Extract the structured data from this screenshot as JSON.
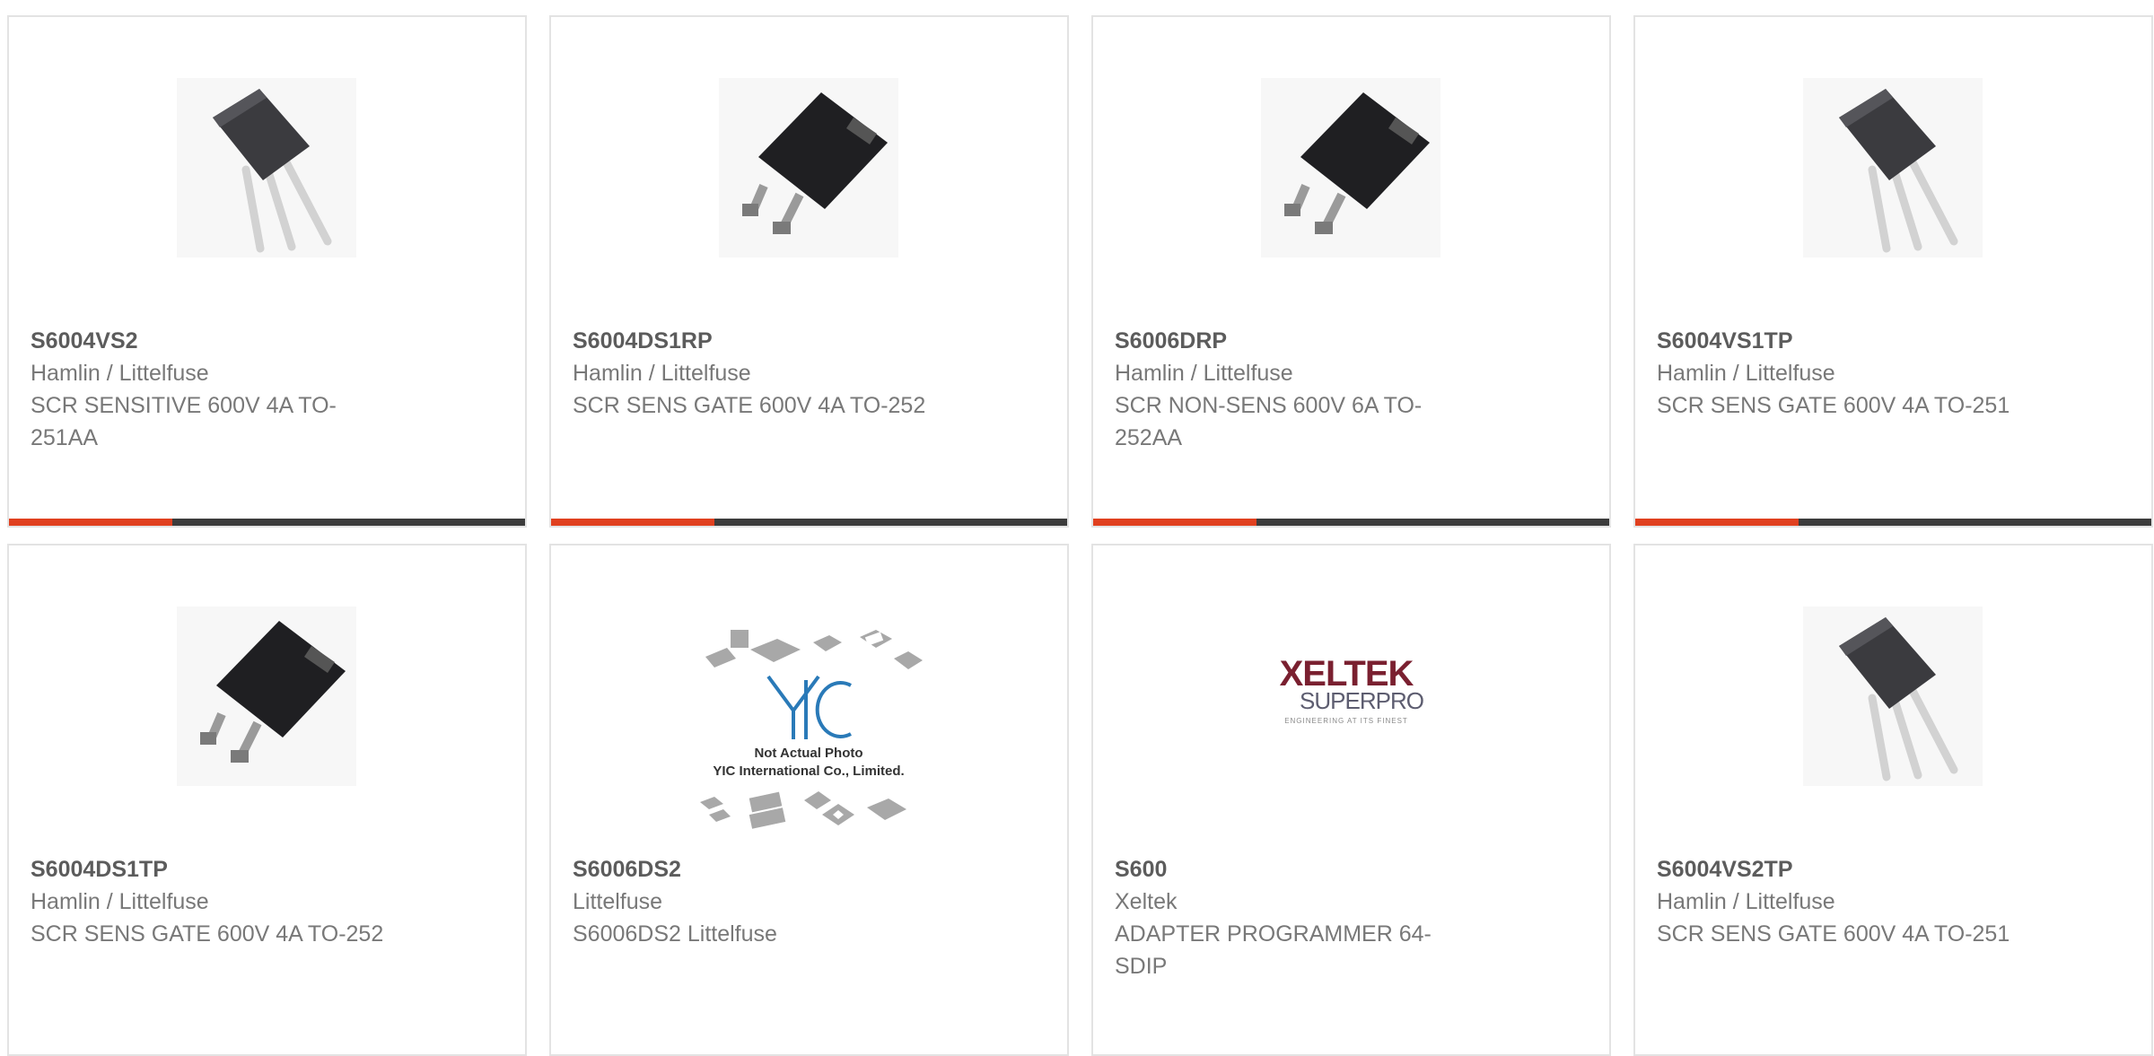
{
  "accent_color": "#e0401f",
  "bar_color": "#3c3c3c",
  "products": [
    {
      "part": "S6004VS2",
      "maker": "Hamlin / Littelfuse",
      "desc": "SCR SENSITIVE 600V 4A TO-251AA",
      "image": "to251-icon"
    },
    {
      "part": "S6004DS1RP",
      "maker": "Hamlin / Littelfuse",
      "desc": "SCR SENS GATE 600V 4A TO-252",
      "image": "to252-icon"
    },
    {
      "part": "S6006DRP",
      "maker": "Hamlin / Littelfuse",
      "desc": "SCR NON-SENS 600V 6A TO-252AA",
      "image": "to252-icon"
    },
    {
      "part": "S6004VS1TP",
      "maker": "Hamlin / Littelfuse",
      "desc": "SCR SENS GATE 600V 4A TO-251",
      "image": "to251-icon"
    },
    {
      "part": "S6004DS1TP",
      "maker": "Hamlin / Littelfuse",
      "desc": "SCR SENS GATE 600V 4A TO-252",
      "image": "to252-icon"
    },
    {
      "part": "S6006DS2",
      "maker": "Littelfuse",
      "desc": "S6006DS2 Littelfuse",
      "image": "yic-placeholder-icon",
      "image_text": {
        "logo": "YIC",
        "line1": "Not Actual Photo",
        "line2": "YIC International Co., Limited."
      }
    },
    {
      "part": "S600",
      "maker": "Xeltek",
      "desc": "ADAPTER PROGRAMMER 64-SDIP",
      "image": "xeltek-logo-icon",
      "image_text": {
        "brand": "XELTEK",
        "product": "SUPERPRO",
        "tagline": "ENGINEERING AT ITS FINEST"
      }
    },
    {
      "part": "S6004VS2TP",
      "maker": "Hamlin / Littelfuse",
      "desc": "SCR SENS GATE 600V 4A TO-251",
      "image": "to251-icon"
    }
  ]
}
